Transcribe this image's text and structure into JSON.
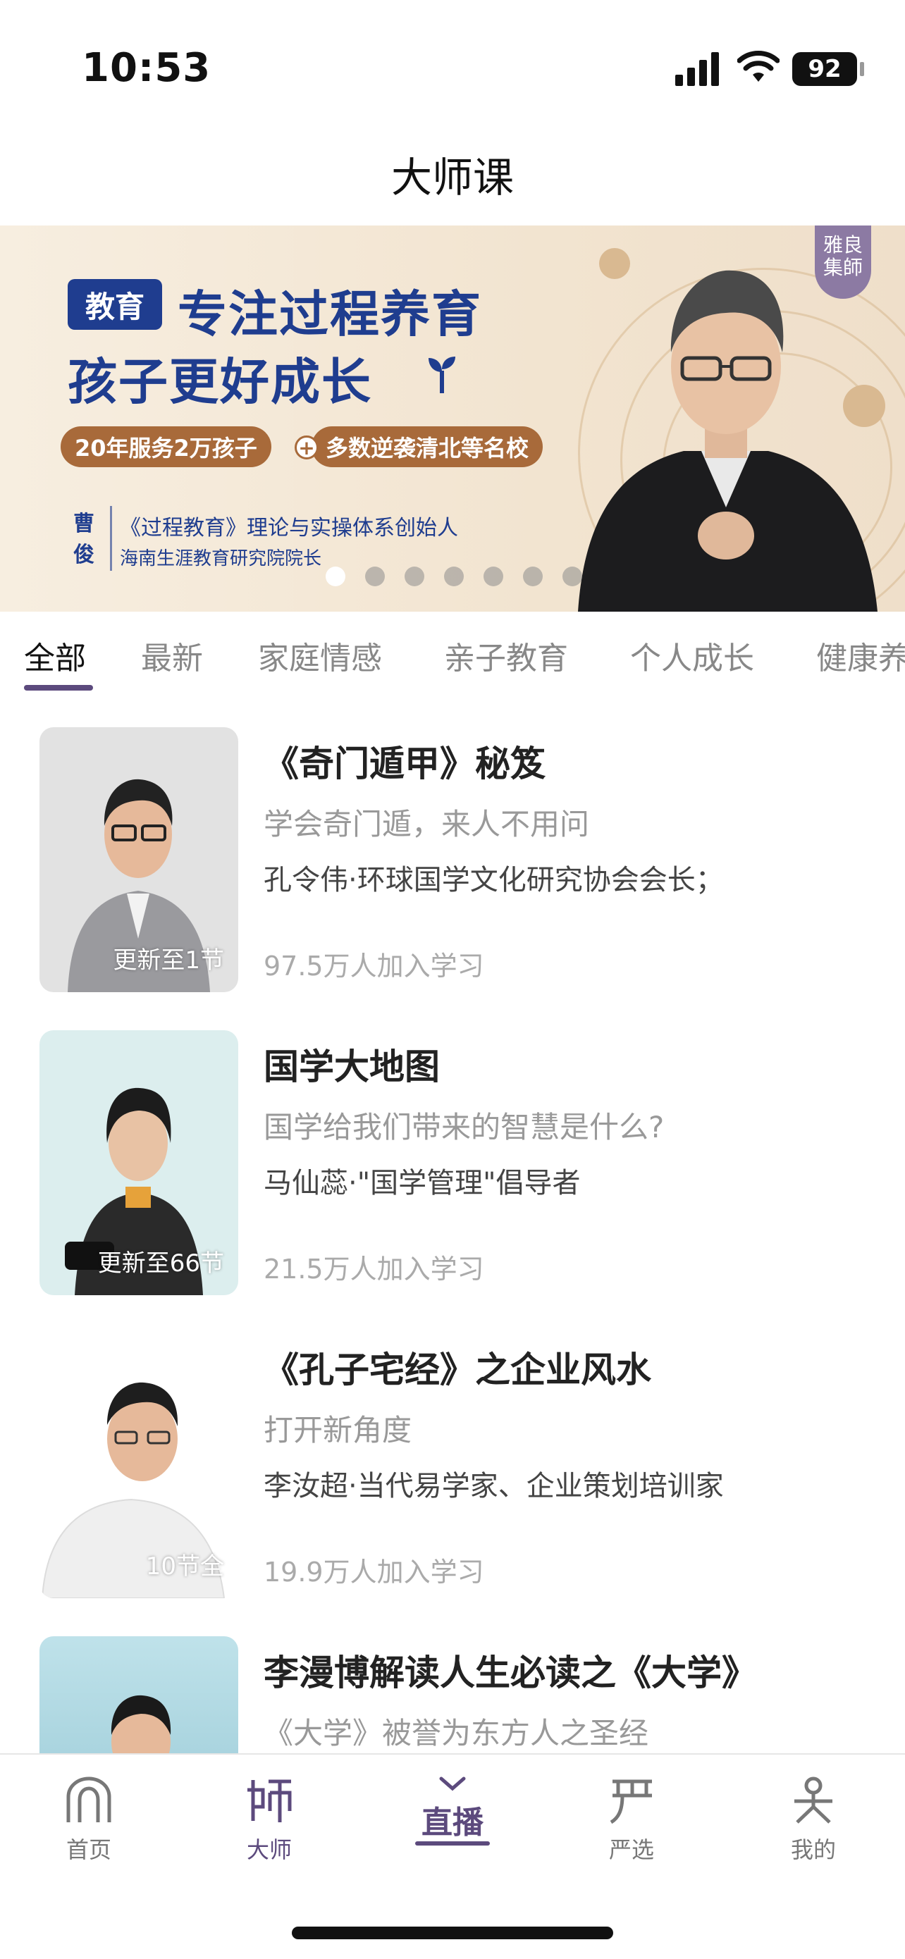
{
  "status_bar": {
    "time": "10:53",
    "battery": "92"
  },
  "page": {
    "title": "大师课"
  },
  "banner": {
    "tag": "教育",
    "headline": "专注过程养育",
    "subheadline": "孩子更好成长",
    "pill1": "20年服务2万孩子",
    "pill_plus": "+",
    "pill2": "多数逆袭清北等名校",
    "name": "曹俊",
    "desc1": "《过程教育》理论与实操体系创始人",
    "desc2": "海南生涯教育研究院院长",
    "logo": "雅良集師",
    "slide_count": 7,
    "active_slide": 0
  },
  "tabs": [
    {
      "label": "全部",
      "active": true
    },
    {
      "label": "最新",
      "active": false
    },
    {
      "label": "家庭情感",
      "active": false
    },
    {
      "label": "亲子教育",
      "active": false
    },
    {
      "label": "个人成长",
      "active": false
    },
    {
      "label": "健康养",
      "active": false
    }
  ],
  "courses": [
    {
      "title": "《奇门遁甲》秘笈",
      "subtitle": "学会奇门遁，来人不用问",
      "author": "孔令伟·环球国学文化研究协会会长；",
      "count": "97.5万人加入学习",
      "badge": "更新至1节"
    },
    {
      "title": "国学大地图",
      "subtitle": "国学给我们带来的智慧是什么?",
      "author": "马仙蕊·\"国学管理\"倡导者",
      "count": "21.5万人加入学习",
      "badge": "更新至66节"
    },
    {
      "title": "《孔子宅经》之企业风水",
      "subtitle": "打开新角度",
      "author": "李汝超·当代易学家、企业策划培训家",
      "count": "19.9万人加入学习",
      "badge": "10节全"
    },
    {
      "title": "李漫博解读人生必读之《大学》",
      "subtitle": "《大学》被誉为东方人之圣经",
      "author": "",
      "count": "",
      "badge": ""
    }
  ],
  "nav": {
    "home": "首页",
    "master": "大师",
    "live": "直播",
    "select": "严选",
    "mine": "我的"
  },
  "colors": {
    "accent": "#5c4a7d",
    "banner_blue": "#1f3d8f",
    "banner_brown": "#a86a3a"
  }
}
